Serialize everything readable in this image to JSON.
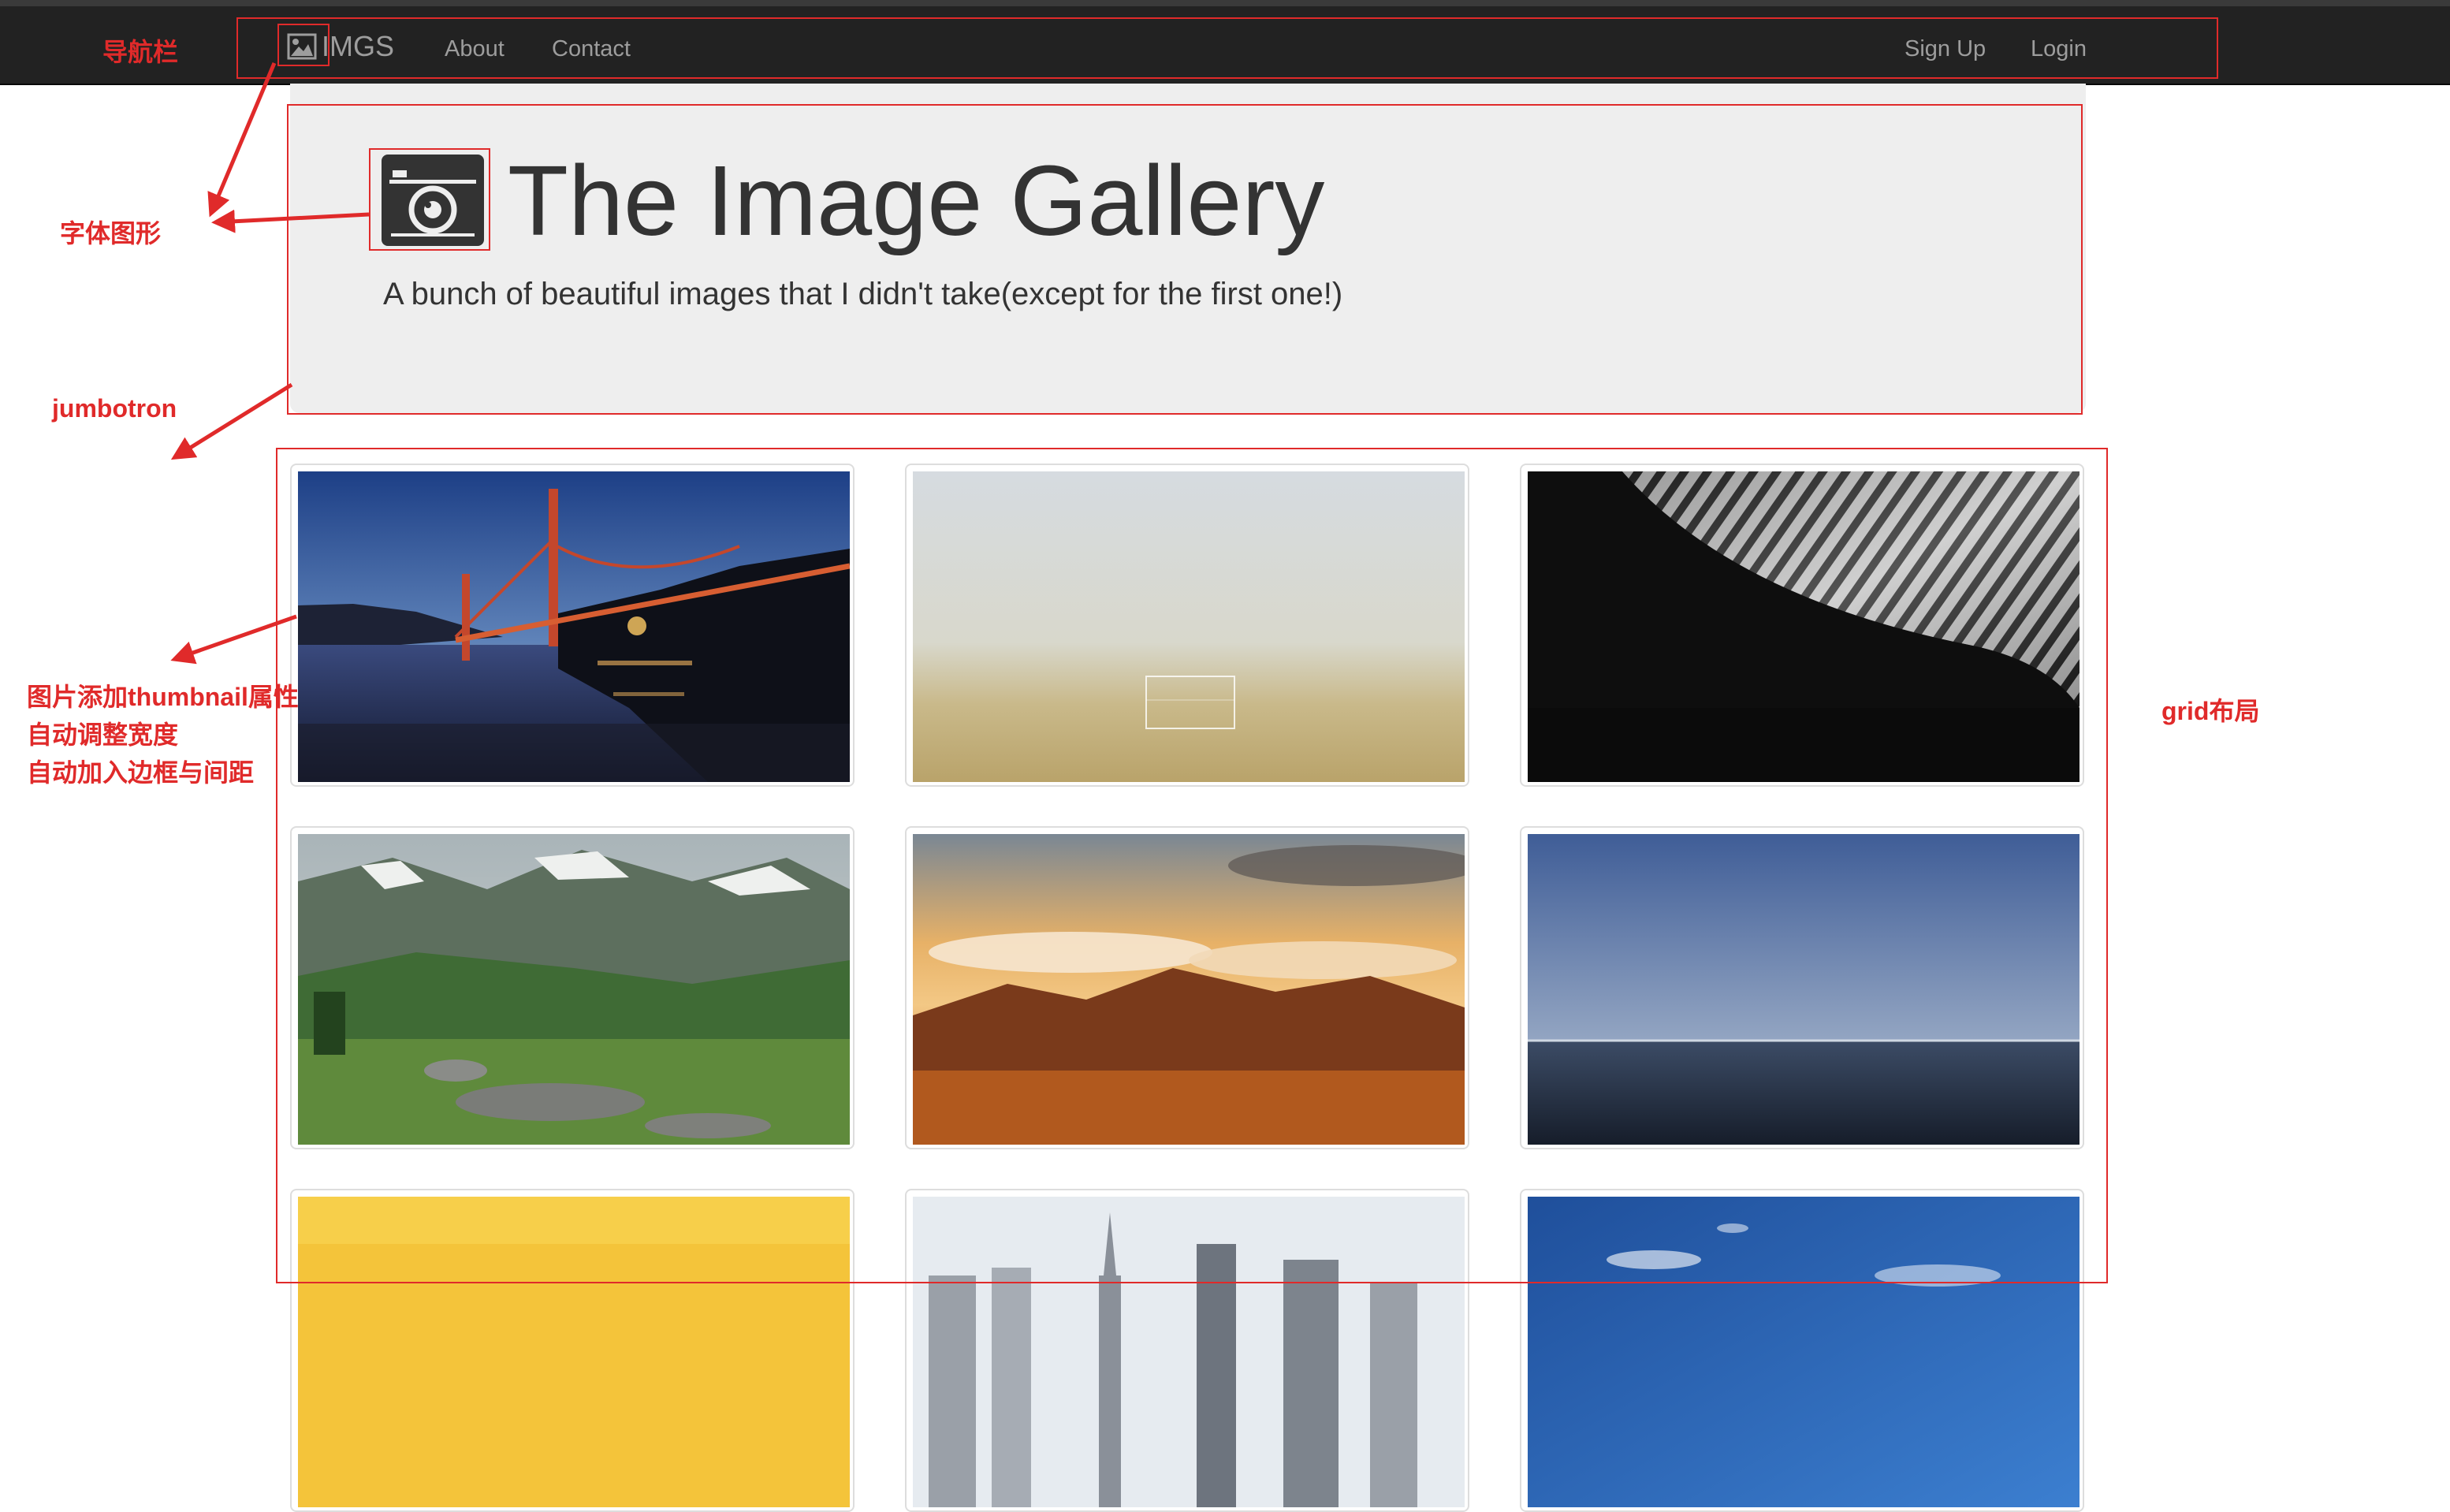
{
  "navbar": {
    "brand": "IMGS",
    "links": [
      "About",
      "Contact"
    ],
    "right_links": [
      "Sign Up",
      "Login"
    ]
  },
  "jumbotron": {
    "title": "The Image Gallery",
    "subtitle": "A bunch of beautiful images that I didn't take(except for the first one!)"
  },
  "gallery": {
    "images": [
      {
        "name": "golden-gate-bridge-image"
      },
      {
        "name": "foggy-field-goal-image"
      },
      {
        "name": "abstract-architecture-image"
      },
      {
        "name": "mountain-meadow-image"
      },
      {
        "name": "sunset-clouds-mountains-image"
      },
      {
        "name": "ocean-horizon-image"
      },
      {
        "name": "yellow-wall-image"
      },
      {
        "name": "city-skyline-image"
      },
      {
        "name": "blue-sky-image"
      }
    ]
  },
  "annotations": {
    "navbar": "导航栏",
    "icon_font": "字体图形",
    "jumbotron": "jumbotron",
    "thumbnail": [
      "图片添加thumbnail属性",
      "自动调整宽度",
      "自动加入边框与间距"
    ],
    "grid": "grid布局"
  },
  "colors": {
    "navbar_bg": "#222222",
    "nav_text": "#9d9d9d",
    "jumbotron_bg": "#eeeeee",
    "annotation": "#e02a2a"
  }
}
